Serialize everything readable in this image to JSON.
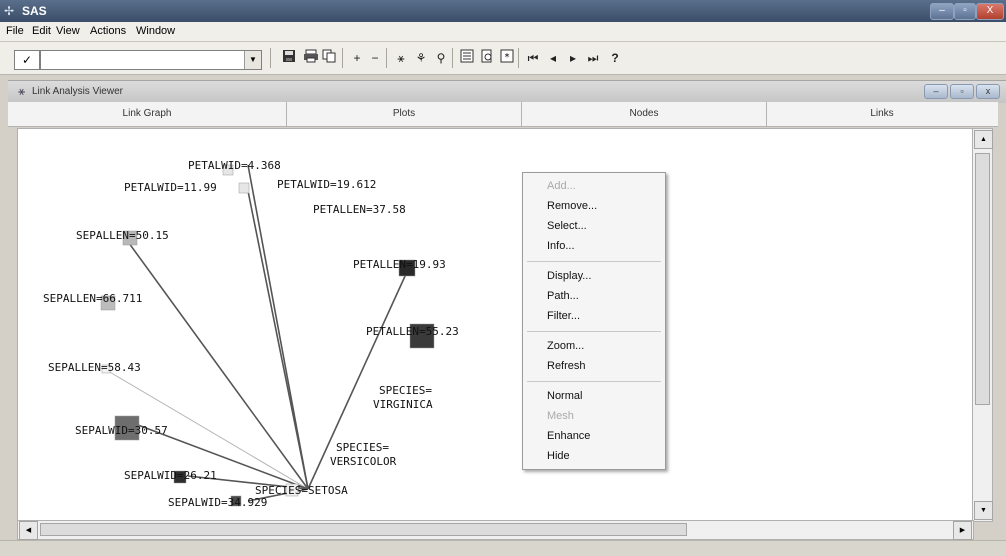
{
  "window": {
    "title": "SAS",
    "min": "–",
    "max": "▫",
    "close": "X"
  },
  "menubar": [
    "File",
    "Edit",
    "View",
    "Actions",
    "Window"
  ],
  "toolbar": {
    "check": "✓",
    "command_value": "",
    "icons": [
      "save-icon",
      "print-icon",
      "copy-icon",
      "plus-icon",
      "minus-icon",
      "link-icon",
      "run-icon",
      "search-icon",
      "list-icon",
      "preview-icon",
      "frame-icon",
      "first-icon",
      "prev-icon",
      "next-icon",
      "last-icon",
      "help-icon"
    ],
    "help": "?"
  },
  "viewer": {
    "title": "Link Analysis Viewer",
    "tabs": [
      "Link Graph",
      "Plots",
      "Nodes",
      "Links"
    ]
  },
  "graph": {
    "nodes": [
      {
        "id": "n1",
        "label": "PETALWID=4.368",
        "shade": "#e6e6e6"
      },
      {
        "id": "n2",
        "label": "PETALWID=11.99",
        "shade": "#e6e6e6"
      },
      {
        "id": "n3",
        "label": "PETALWID=19.612",
        "shade": "#ffffff"
      },
      {
        "id": "n4",
        "label": "PETALLEN=37.58",
        "shade": "#ffffff"
      },
      {
        "id": "n5",
        "label": "SEPALLEN=50.15",
        "shade": "#b8b8b8"
      },
      {
        "id": "n6",
        "label": "PETALLEN=19.93",
        "shade": "#2a2a2a"
      },
      {
        "id": "n7",
        "label": "SEPALLEN=66.711",
        "shade": "#bcbcbc"
      },
      {
        "id": "n8",
        "label": "PETALLEN=55.23",
        "shade": "#3a3a3a"
      },
      {
        "id": "n9",
        "label": "SEPALLEN=58.43",
        "shade": "#f2f2f2"
      },
      {
        "id": "n10",
        "label": "SPECIES=VIRGINICA",
        "shade": "#ffffff"
      },
      {
        "id": "n11",
        "label": "SEPALWID=30.57",
        "shade": "#6e6e6e"
      },
      {
        "id": "n12",
        "label": "SPECIES=VERSICOLOR",
        "shade": "#ffffff"
      },
      {
        "id": "n13",
        "label": "SEPALWID=26.21",
        "shade": "#2e2e2e"
      },
      {
        "id": "n14",
        "label": "SPECIES=SETOSA",
        "shade": "#f0f0f0"
      },
      {
        "id": "n15",
        "label": "SEPALWID=34.929",
        "shade": "#4a4a4a"
      }
    ],
    "links": [
      {
        "from": "n14",
        "to": "n1",
        "style": "solid"
      },
      {
        "from": "n14",
        "to": "n2",
        "style": "solid"
      },
      {
        "from": "n14",
        "to": "n5",
        "style": "solid"
      },
      {
        "from": "n14",
        "to": "n6",
        "style": "solid"
      },
      {
        "from": "n14",
        "to": "n9",
        "style": "faint"
      },
      {
        "from": "n14",
        "to": "n11",
        "style": "solid"
      },
      {
        "from": "n14",
        "to": "n13",
        "style": "solid"
      },
      {
        "from": "n14",
        "to": "n15",
        "style": "solid"
      }
    ]
  },
  "context_menu": {
    "items": [
      {
        "label": "Add...",
        "enabled": false
      },
      {
        "label": "Remove...",
        "enabled": true
      },
      {
        "label": "Select...",
        "enabled": true
      },
      {
        "label": "Info...",
        "enabled": true
      },
      {
        "label": "Display...",
        "enabled": true
      },
      {
        "label": "Path...",
        "enabled": true
      },
      {
        "label": "Filter...",
        "enabled": true
      },
      {
        "label": "Zoom...",
        "enabled": true
      },
      {
        "label": "Refresh",
        "enabled": true
      },
      {
        "label": "Normal",
        "enabled": true
      },
      {
        "label": "Mesh",
        "enabled": false
      },
      {
        "label": "Enhance",
        "enabled": true
      },
      {
        "label": "Hide",
        "enabled": true
      }
    ]
  }
}
